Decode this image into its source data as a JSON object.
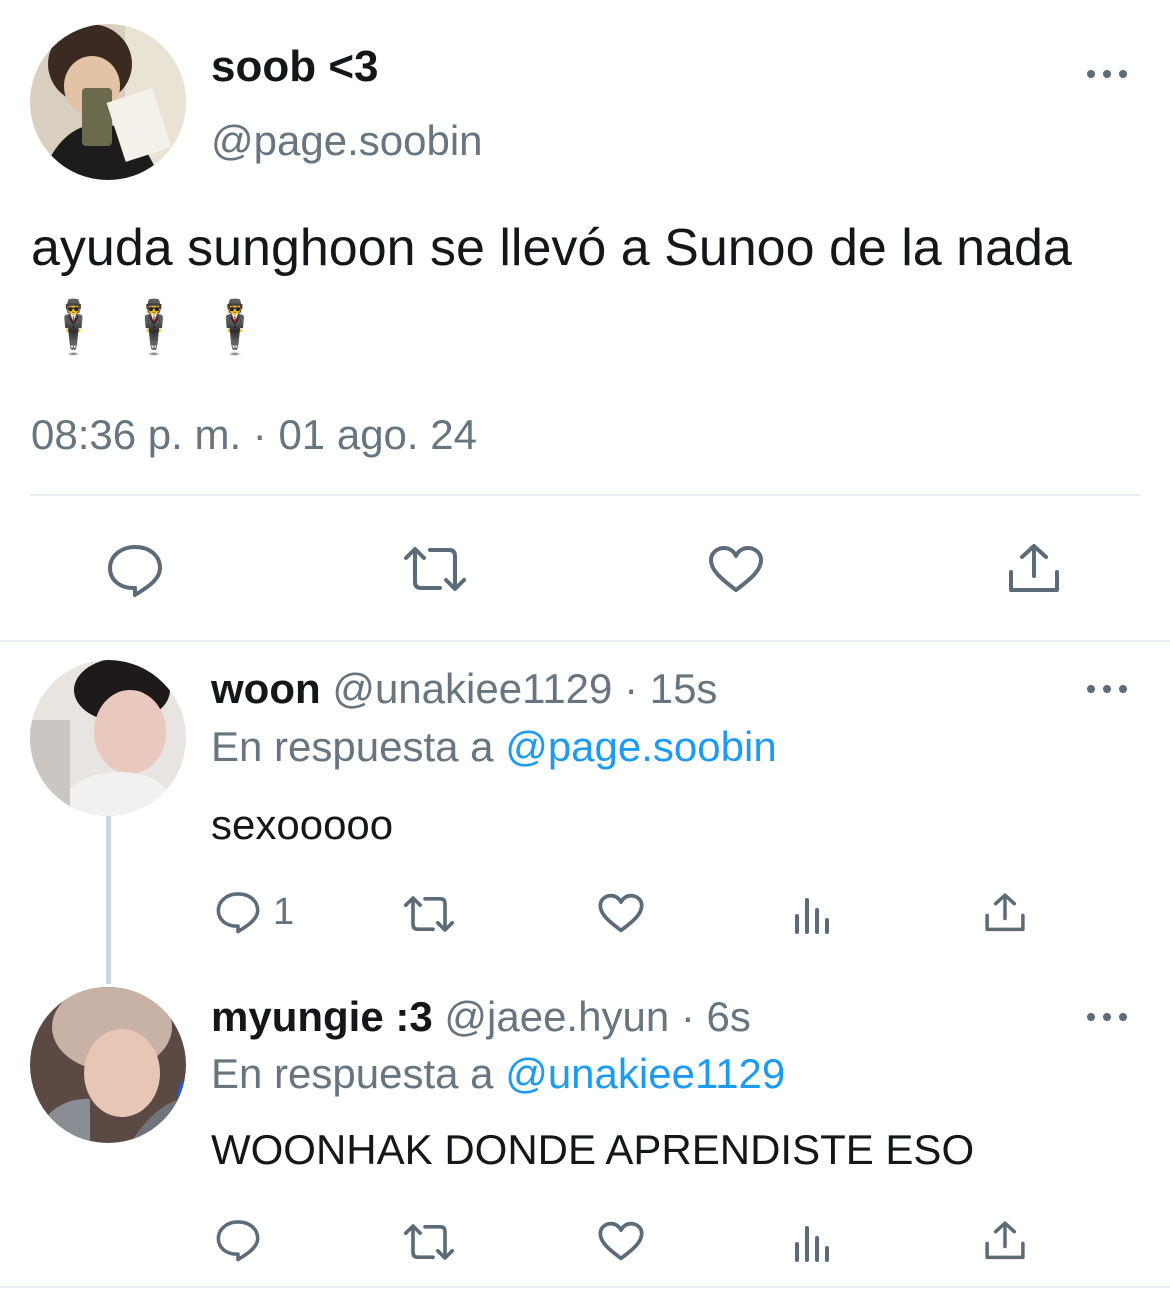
{
  "main_tweet": {
    "display_name": "soob <3",
    "handle": "@page.soobin",
    "text": "ayuda sunghoon se llevó a Sunoo de la nada",
    "emojis": "🕴️🕴️🕴️",
    "timestamp": "08:36 p. m. · 01 ago. 24",
    "actions": [
      "reply-icon",
      "retweet-icon",
      "like-icon",
      "share-icon"
    ]
  },
  "replies": [
    {
      "display_name": "woon",
      "handle": "@unakiee1129",
      "time": "· 15s",
      "reply_prefix": "En respuesta a",
      "reply_to": "@page.soobin",
      "text": "sexooooo",
      "reply_count": "1",
      "actions": [
        "reply-icon",
        "retweet-icon",
        "like-icon",
        "analytics-icon",
        "share-icon"
      ]
    },
    {
      "display_name": "myungie :3",
      "handle": "@jaee.hyun",
      "time": "· 6s",
      "reply_prefix": "En respuesta a",
      "reply_to": "@unakiee1129",
      "text": "WOONHAK DONDE APRENDISTE ESO",
      "reply_count": "",
      "actions": [
        "reply-icon",
        "retweet-icon",
        "like-icon",
        "analytics-icon",
        "share-icon"
      ]
    }
  ],
  "colors": {
    "text": "#14171a",
    "secondary": "#66757f",
    "link": "#1d9bf0",
    "icon": "#5b6b78",
    "divider": "#e6ecf0"
  }
}
